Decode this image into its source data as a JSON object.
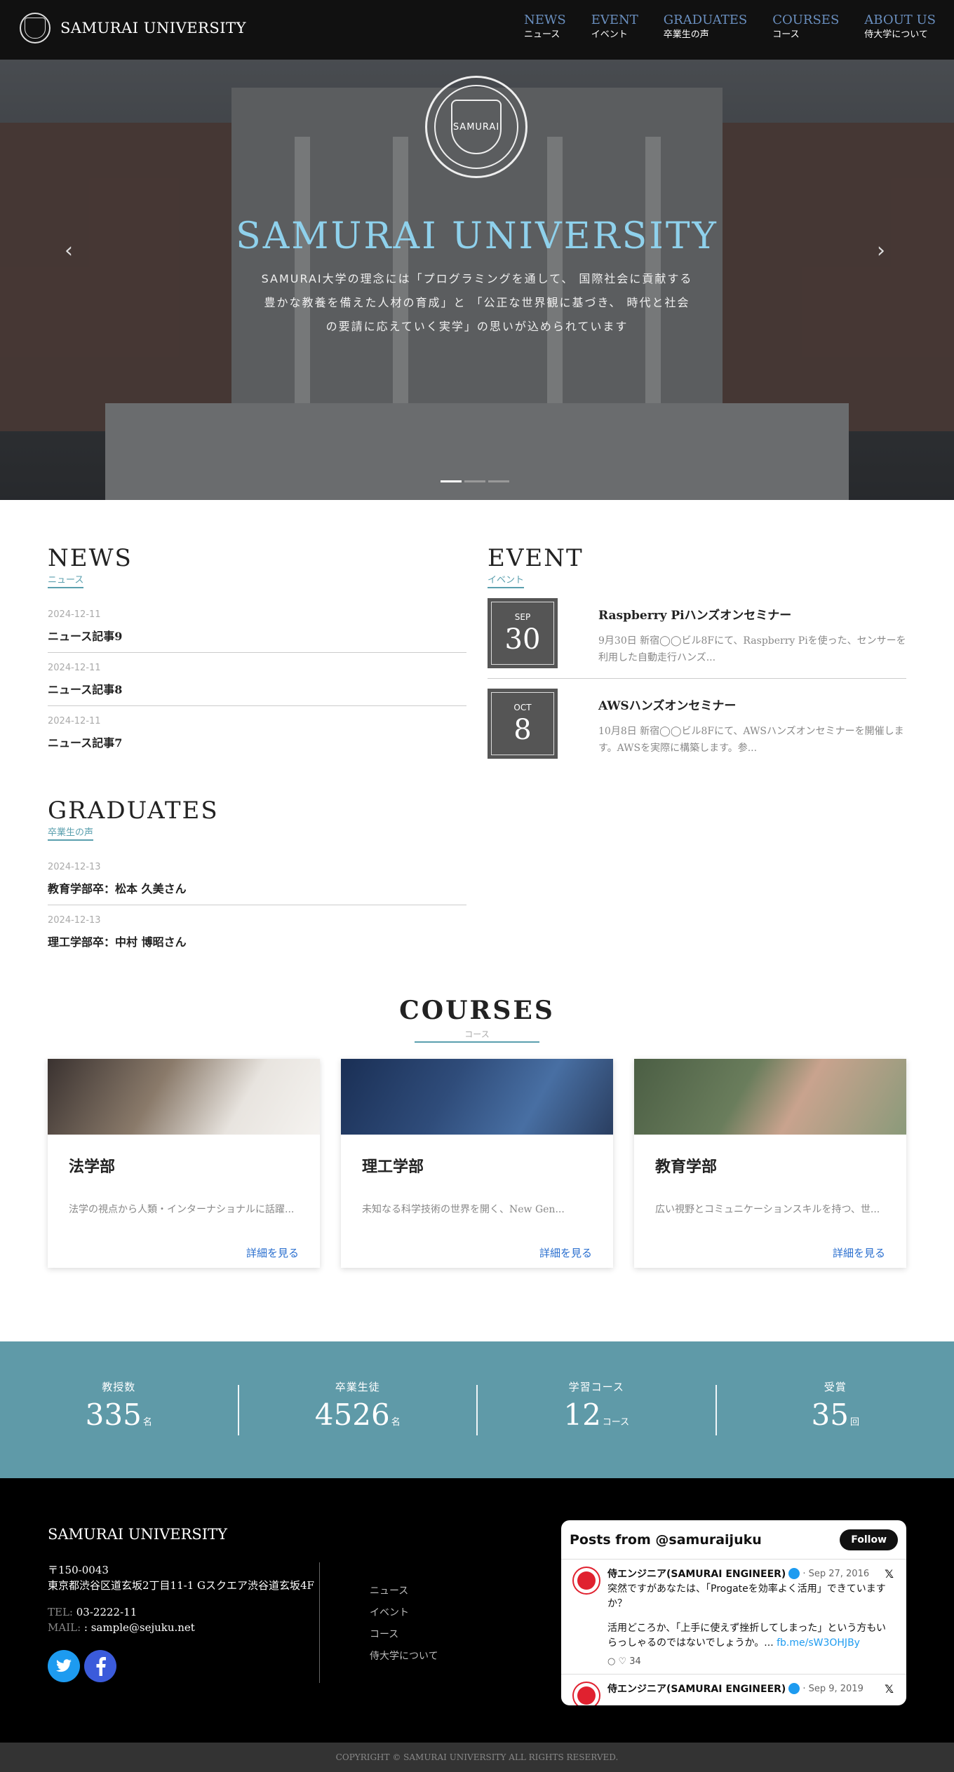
{
  "header": {
    "site_name": "SAMURAI UNIVERSITY",
    "nav": [
      {
        "en": "NEWS",
        "ja": "ニュース"
      },
      {
        "en": "EVENT",
        "ja": "イベント"
      },
      {
        "en": "GRADUATES",
        "ja": "卒業生の声"
      },
      {
        "en": "COURSES",
        "ja": "コース"
      },
      {
        "en": "ABOUT US",
        "ja": "侍大学について"
      }
    ]
  },
  "hero": {
    "crest_label": "SAMURAI",
    "title": "SAMURAI UNIVERSITY",
    "description": "SAMURAI大学の理念には「プログラミングを通して、 国際社会に貢献する豊かな教養を備えた人材の育成」と 「公正な世界観に基づき、 時代と社会の要請に応えていく実学」の思いが込められています",
    "prev_icon": "‹",
    "next_icon": "›"
  },
  "news": {
    "title_en": "NEWS",
    "title_ja": "ニュース",
    "items": [
      {
        "date": "2024-12-11",
        "title": "ニュース記事9"
      },
      {
        "date": "2024-12-11",
        "title": "ニュース記事8"
      },
      {
        "date": "2024-12-11",
        "title": "ニュース記事7"
      }
    ]
  },
  "event": {
    "title_en": "EVENT",
    "title_ja": "イベント",
    "items": [
      {
        "month": "SEP",
        "day": "30",
        "title": "Raspberry Piハンズオンセミナー",
        "text": "9月30日 新宿◯◯ビル8Fにて、Raspberry Piを使った、センサーを利用した自動走行ハンズ..."
      },
      {
        "month": "OCT",
        "day": "8",
        "title": "AWSハンズオンセミナー",
        "text": "10月8日 新宿◯◯ビル8Fにて、AWSハンズオンセミナーを開催します。AWSを実際に構築します。参..."
      }
    ]
  },
  "graduates": {
    "title_en": "GRADUATES",
    "title_ja": "卒業生の声",
    "items": [
      {
        "date": "2024-12-13",
        "title": "教育学部卒：松本 久美さん"
      },
      {
        "date": "2024-12-13",
        "title": "理工学部卒：中村 博昭さん"
      }
    ]
  },
  "courses": {
    "title_en": "COURSES",
    "title_ja": "コース",
    "link_label": "詳細を見る",
    "items": [
      {
        "title": "法学部",
        "desc": "法学の視点から人類・インターナショナルに話躍..."
      },
      {
        "title": "理工学部",
        "desc": "未知なる科学技術の世界を開く、New Gen..."
      },
      {
        "title": "教育学部",
        "desc": "広い視野とコミュニケーションスキルを持つ、世..."
      }
    ]
  },
  "stats": [
    {
      "label": "教授数",
      "value": "335",
      "unit": "名"
    },
    {
      "label": "卒業生徒",
      "value": "4526",
      "unit": "名"
    },
    {
      "label": "学習コース",
      "value": "12",
      "unit": "コース"
    },
    {
      "label": "受賞",
      "value": "35",
      "unit": "回"
    }
  ],
  "footer": {
    "title": "SAMURAI UNIVERSITY",
    "postal": "〒150-0043",
    "address": "東京都渋谷区道玄坂2丁目11-1 Gスクエア渋谷道玄坂4F",
    "tel_label": "TEL: ",
    "tel": "03-2222-11",
    "mail_label": "MAIL: ",
    "mail": ": sample@sejuku.net",
    "twitter_icon": "twitter-icon",
    "facebook_icon": "facebook-icon",
    "links": [
      "ニュース",
      "イベント",
      "コース",
      "侍大学について"
    ]
  },
  "twitter": {
    "header": "Posts from @samuraijuku",
    "follow": "Follow",
    "posts": [
      {
        "name": "侍エンジニア(SAMURAI ENGINEER)",
        "date": "· Sep 27, 2016",
        "text": "突然ですがあなたは、「Progateを効率よく活用」できていますか？",
        "text2": "活用どころか、「上手に使えず挫折してしまった」という方もいらっしゃるのではないでしょうか。...",
        "link": "fb.me/sW3OHJBy",
        "likes": "34"
      },
      {
        "name": "侍エンジニア(SAMURAI ENGINEER)",
        "date": "· Sep 9, 2019"
      }
    ]
  },
  "copyright": "COPYRIGHT © SAMURAI UNIVERSITY ALL RIGHTS RESERVED.",
  "colors": {
    "accent": "#5f9aa8",
    "hero_title": "#8fd1ec",
    "link": "#2a6fcf"
  }
}
